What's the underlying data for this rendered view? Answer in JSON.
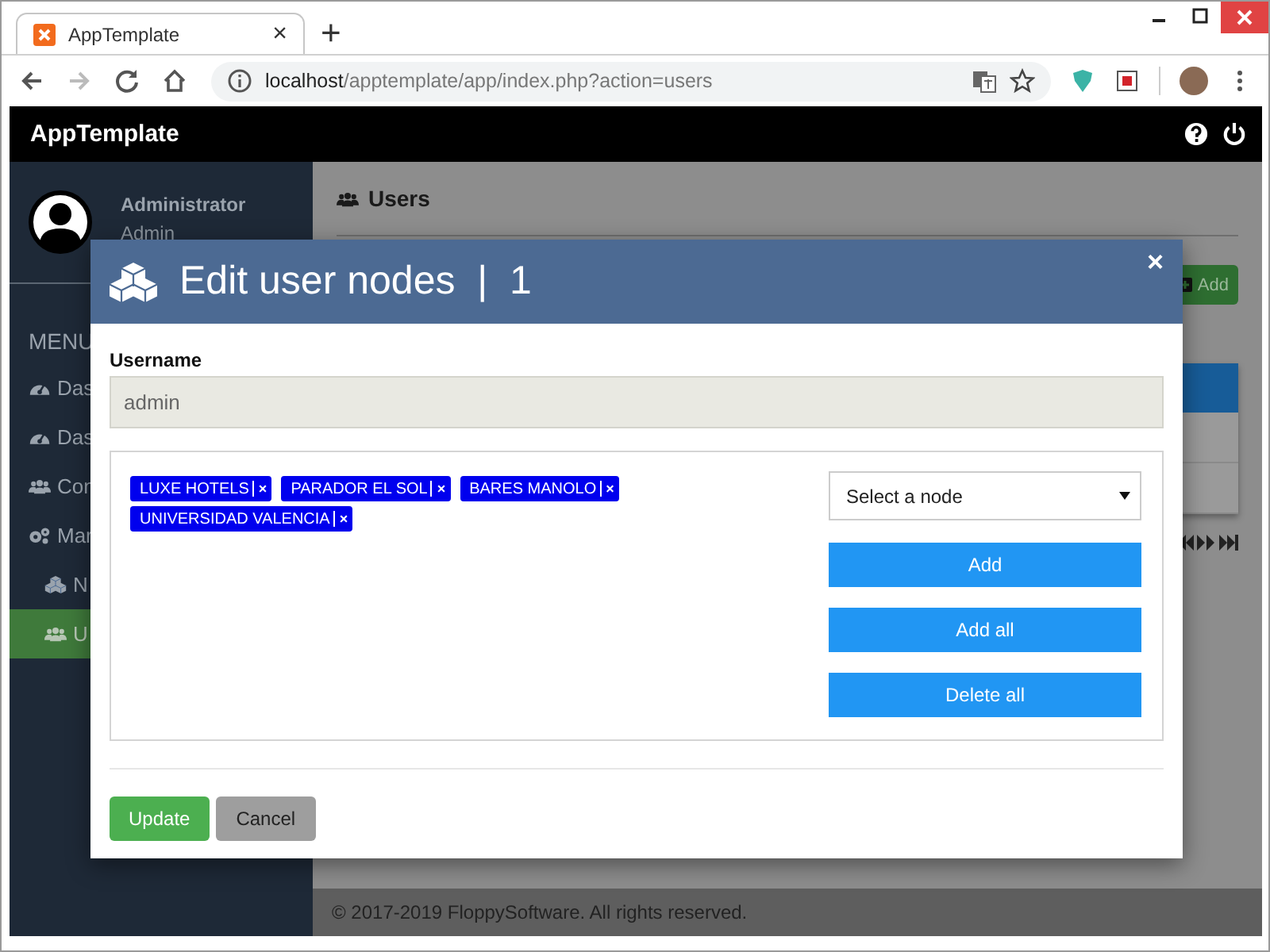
{
  "browser": {
    "tab_title": "AppTemplate",
    "close_tab": "×",
    "new_tab": "+",
    "url_host": "localhost",
    "url_path": "/apptemplate/app/index.php?action=users",
    "forward_disabled": true
  },
  "app": {
    "title": "AppTemplate"
  },
  "sidebar": {
    "user_name": "Administrator",
    "user_role": "Admin",
    "menu_title": "MENU",
    "items": [
      {
        "label": "Das",
        "selected": false
      },
      {
        "label": "Das",
        "selected": false
      },
      {
        "label": "Con",
        "selected": false
      },
      {
        "label": "Mar",
        "selected": false,
        "children": [
          {
            "label": "N",
            "selected": false
          },
          {
            "label": "U",
            "selected": true
          }
        ]
      }
    ]
  },
  "page": {
    "title": "Users",
    "add_button": "Add"
  },
  "modal": {
    "title": "Edit user nodes  |  1",
    "close": "×",
    "username_label": "Username",
    "username_value": "admin",
    "tags": [
      {
        "label": "LUXE HOTELS",
        "remove": "×"
      },
      {
        "label": "PARADOR EL SOL",
        "remove": "×"
      },
      {
        "label": "BARES MANOLO",
        "remove": "×"
      },
      {
        "label": "UNIVERSIDAD VALENCIA",
        "remove": "×"
      }
    ],
    "select_placeholder": "Select a node",
    "actions": [
      "Add",
      "Add all",
      "Delete all"
    ],
    "update": "Update",
    "cancel": "Cancel"
  },
  "footer": "© 2017-2019 FloppySoftware. All rights reserved."
}
